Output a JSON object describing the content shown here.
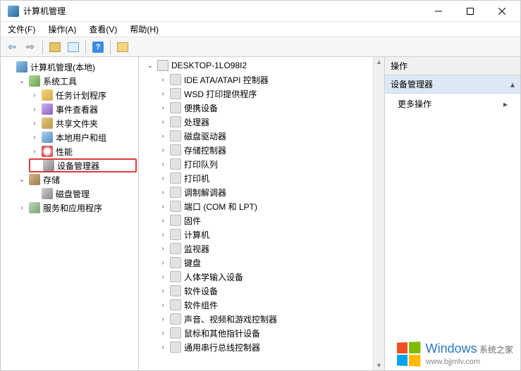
{
  "window": {
    "title": "计算机管理",
    "minimize_tip": "最小化",
    "maximize_tip": "最大化",
    "close_tip": "关闭"
  },
  "menu": {
    "file": "文件(F)",
    "action": "操作(A)",
    "view": "查看(V)",
    "help": "帮助(H)"
  },
  "toolbar": {
    "back": "back-icon",
    "forward": "forward-icon",
    "up_folder": "up-folder-icon",
    "properties": "properties-icon",
    "help": "help-icon",
    "show_hide": "show-hide-icon"
  },
  "left_tree": {
    "root": "计算机管理(本地)",
    "system_tools": "系统工具",
    "task_scheduler": "任务计划程序",
    "event_viewer": "事件查看器",
    "shared_folders": "共享文件夹",
    "local_users": "本地用户和组",
    "performance": "性能",
    "device_manager": "设备管理器",
    "storage": "存储",
    "disk_management": "磁盘管理",
    "services_apps": "服务和应用程序"
  },
  "mid_tree": {
    "computer": "DESKTOP-1LO98I2",
    "items": [
      "IDE ATA/ATAPI 控制器",
      "WSD 打印提供程序",
      "便携设备",
      "处理器",
      "磁盘驱动器",
      "存储控制器",
      "打印队列",
      "打印机",
      "调制解调器",
      "端口 (COM 和 LPT)",
      "固件",
      "计算机",
      "监视器",
      "键盘",
      "人体学输入设备",
      "软件设备",
      "软件组件",
      "声音、视频和游戏控制器",
      "鼠标和其他指针设备",
      "通用串行总线控制器"
    ]
  },
  "right_pane": {
    "header": "操作",
    "selection": "设备管理器",
    "more_actions": "更多操作"
  },
  "watermark": {
    "brand": "Windows",
    "suffix": "系统之家",
    "url": "www.bjjmlv.com"
  }
}
